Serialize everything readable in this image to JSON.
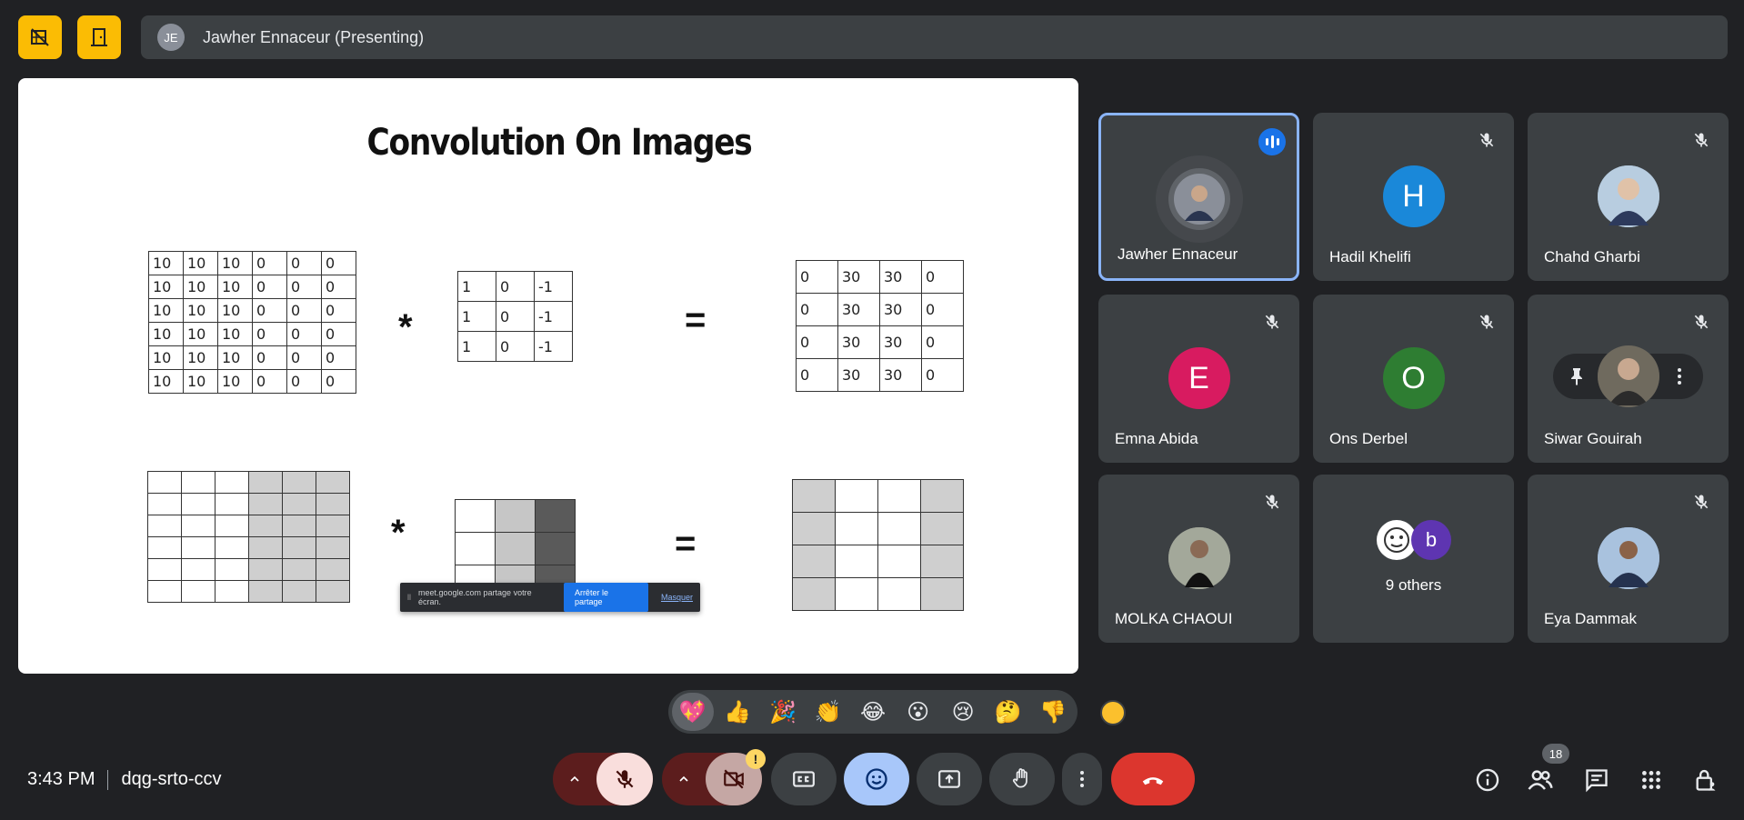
{
  "top_bar": {
    "presenter_initials": "JE",
    "presenting_label": "Jawher Ennaceur (Presenting)"
  },
  "slide": {
    "title": "Convolution On Images",
    "input_matrix": [
      [
        "10",
        "10",
        "10",
        "0",
        "0",
        "0"
      ],
      [
        "10",
        "10",
        "10",
        "0",
        "0",
        "0"
      ],
      [
        "10",
        "10",
        "10",
        "0",
        "0",
        "0"
      ],
      [
        "10",
        "10",
        "10",
        "0",
        "0",
        "0"
      ],
      [
        "10",
        "10",
        "10",
        "0",
        "0",
        "0"
      ],
      [
        "10",
        "10",
        "10",
        "0",
        "0",
        "0"
      ]
    ],
    "kernel_matrix": [
      [
        "1",
        "0",
        "-1"
      ],
      [
        "1",
        "0",
        "-1"
      ],
      [
        "1",
        "0",
        "-1"
      ]
    ],
    "output_matrix": [
      [
        "0",
        "30",
        "30",
        "0"
      ],
      [
        "0",
        "30",
        "30",
        "0"
      ],
      [
        "0",
        "30",
        "30",
        "0"
      ],
      [
        "0",
        "30",
        "30",
        "0"
      ]
    ],
    "operator_multiply": "*",
    "operator_equals": "=",
    "colors": {
      "light_gray": "#cfcfcf",
      "mid_gray": "#c6c6c6",
      "dark_gray": "#5a5a5a"
    }
  },
  "share_banner": {
    "message": "meet.google.com partage votre écran.",
    "stop_label": "Arrêter le partage",
    "hide_label": "Masquer"
  },
  "participants": [
    {
      "name": "Jawher Ennaceur",
      "initial": "",
      "color": "#6b6f76",
      "speaking": true,
      "muted": false
    },
    {
      "name": "Hadil Khelifi",
      "initial": "H",
      "color": "#1a88d9",
      "muted": true
    },
    {
      "name": "Chahd Gharbi",
      "initial": "",
      "color": "#8aa6c4",
      "muted": true
    },
    {
      "name": "Emna Abida",
      "initial": "E",
      "color": "#d81b60",
      "muted": true
    },
    {
      "name": "Ons Derbel",
      "initial": "O",
      "color": "#2e7d32",
      "muted": true
    },
    {
      "name": "Siwar Gouirah",
      "initial": "",
      "color": "#4a4a4a",
      "muted": true
    },
    {
      "name": "MOLKA CHAOUI",
      "initial": "",
      "color": "#8d8f86",
      "muted": true
    },
    {
      "name": "Eya Dammak",
      "initial": "",
      "color": "#7f9cc2",
      "muted": true
    }
  ],
  "others_tile": {
    "label": "9 others",
    "initial": "b",
    "initial_color": "#5e35b1"
  },
  "reactions": [
    "💖",
    "👍",
    "🎉",
    "👏",
    "😂",
    "😮",
    "😢",
    "🤔",
    "👎"
  ],
  "meeting": {
    "time": "3:43 PM",
    "code": "dqg-srto-ccv"
  },
  "people_count": "18",
  "camera_warning": "!"
}
